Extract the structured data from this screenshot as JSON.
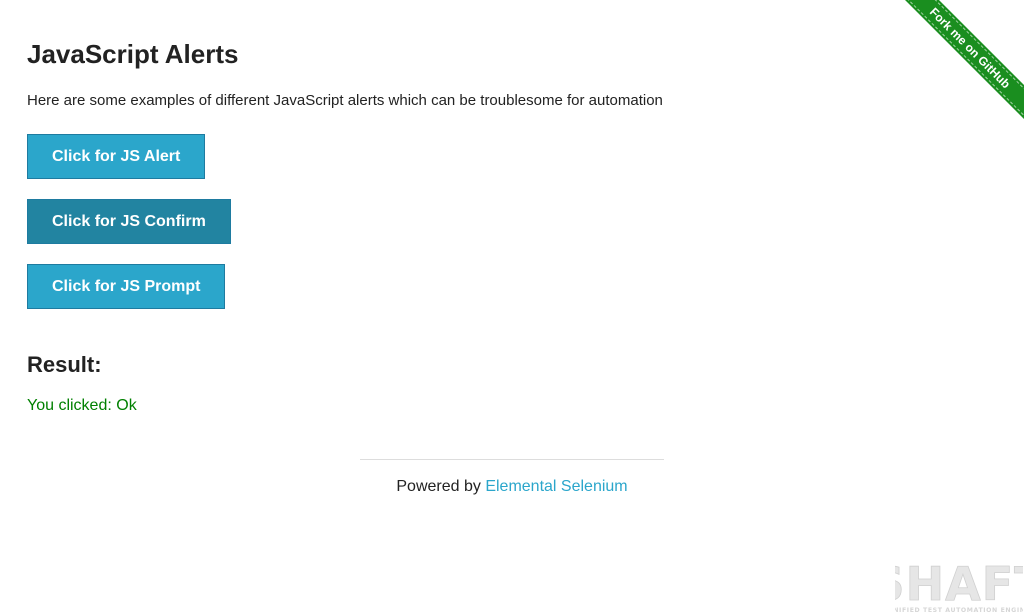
{
  "page": {
    "title": "JavaScript Alerts",
    "intro": "Here are some examples of different JavaScript alerts which can be troublesome for automation"
  },
  "buttons": {
    "alert_label": "Click for JS Alert",
    "confirm_label": "Click for JS Confirm",
    "prompt_label": "Click for JS Prompt"
  },
  "result": {
    "heading": "Result:",
    "text": "You clicked: Ok"
  },
  "footer": {
    "powered_by": "Powered by",
    "link_text": "Elemental Selenium"
  },
  "ribbon": {
    "text": "Fork me on GitHub"
  },
  "watermark": {
    "logo_text": "SHAFT",
    "tagline": "UNIFIED TEST AUTOMATION ENGINE"
  },
  "colors": {
    "button": "#2ba6cb",
    "button_active": "#2284a1",
    "result_text": "#008000",
    "link": "#2ba6cb",
    "ribbon": "#1a8e1f"
  }
}
